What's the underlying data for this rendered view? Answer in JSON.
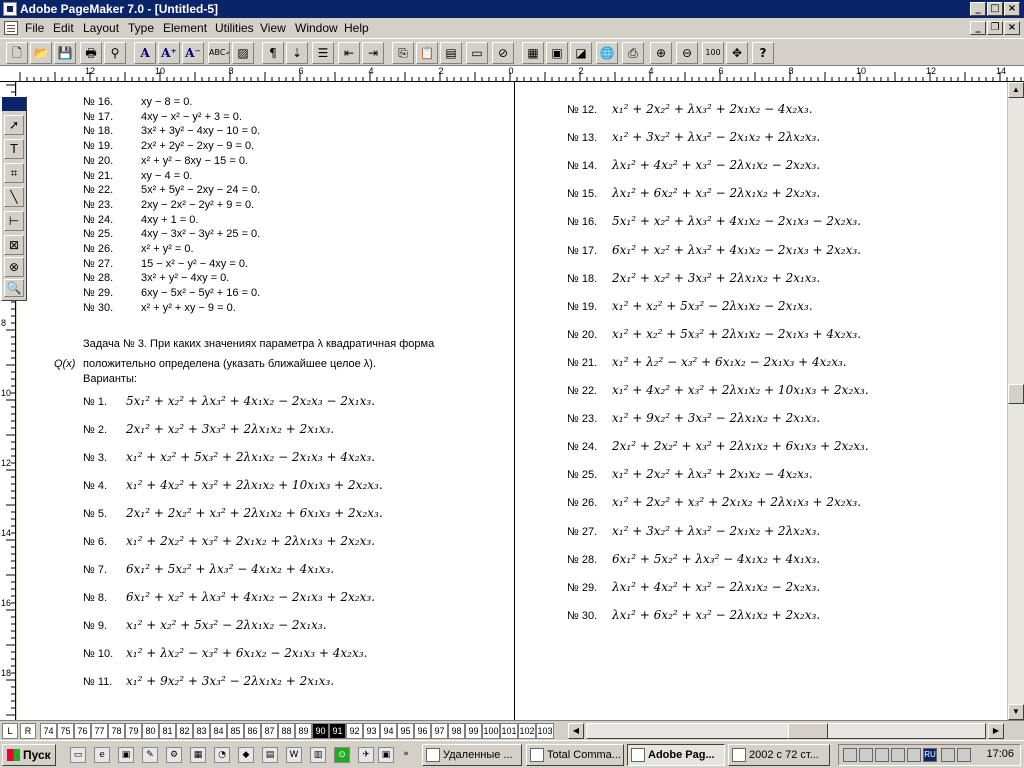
{
  "window": {
    "title": "Adobe PageMaker 7.0 - [Untitled-5]"
  },
  "menu": [
    "File",
    "Edit",
    "Layout",
    "Type",
    "Element",
    "Utilities",
    "View",
    "Window",
    "Help"
  ],
  "toolbar": {
    "buttons": [
      "new",
      "open",
      "save",
      "print",
      "find",
      "A",
      "A+",
      "A-",
      "spell",
      "rect",
      "¶",
      "text-flow",
      "bullets",
      "outdent",
      "indent",
      "copy",
      "paste",
      "clip",
      "frame",
      "link",
      "color",
      "place",
      "world",
      "print-pdf",
      "acrobat",
      "zoom-in",
      "zoom-out",
      "100",
      "fit",
      "?"
    ]
  },
  "hruler": {
    "labels": [
      "12",
      "10",
      "8",
      "6",
      "4",
      "2",
      "0",
      "2",
      "4",
      "6",
      "8",
      "10",
      "12",
      "14"
    ]
  },
  "vruler": {
    "labels": [
      "8",
      "10",
      "12",
      "14",
      "16",
      "18"
    ]
  },
  "toolbox": {
    "tools": [
      "pointer",
      "text",
      "crop",
      "line",
      "constrained-line",
      "rectangle-frame",
      "ellipse",
      "ellipse-frame",
      "zoom"
    ]
  },
  "left_eqs": [
    {
      "no": "№ 16.",
      "eq": "xy − 8 = 0."
    },
    {
      "no": "№ 17.",
      "eq": "4xy − x² − y² + 3 = 0."
    },
    {
      "no": "№ 18.",
      "eq": "3x² + 3y² − 4xy − 10 = 0."
    },
    {
      "no": "№ 19.",
      "eq": "2x² + 2y² − 2xy − 9 = 0."
    },
    {
      "no": "№ 20.",
      "eq": "x² + y² − 8xy − 15 = 0."
    },
    {
      "no": "№ 21.",
      "eq": "xy − 4 = 0."
    },
    {
      "no": "№ 22.",
      "eq": "5x² + 5y² − 2xy − 24 = 0."
    },
    {
      "no": "№ 23.",
      "eq": "2xy − 2x² − 2y² + 9 = 0."
    },
    {
      "no": "№ 24.",
      "eq": "4xy + 1 = 0."
    },
    {
      "no": "№ 25.",
      "eq": "4xy − 3x² − 3y² + 25 = 0."
    },
    {
      "no": "№ 26.",
      "eq": "x² + y² = 0."
    },
    {
      "no": "№ 27.",
      "eq": "15 − x² − y² − 4xy = 0."
    },
    {
      "no": "№ 28.",
      "eq": "3x² + y² − 4xy = 0."
    },
    {
      "no": "№ 29.",
      "eq": "6xy − 5x² − 5y² + 16 = 0."
    },
    {
      "no": "№ 30.",
      "eq": "x² + y² + xy − 9 = 0."
    }
  ],
  "task3": {
    "line1": "Задача № 3. При каких значениях параметра λ квадратичная форма",
    "qx": "Q(x)",
    "line2": "положительно определена (указать ближайшее целое λ).",
    "line3": "Варианты:"
  },
  "left_forms": [
    {
      "no": "№ 1.",
      "eq": "5x₁² + x₂² + λx₃² + 4x₁x₂ − 2x₂x₃ − 2x₁x₃."
    },
    {
      "no": "№ 2.",
      "eq": "2x₁² + x₂² + 3x₃² + 2λx₁x₂ + 2x₁x₃."
    },
    {
      "no": "№ 3.",
      "eq": "x₁² + x₂² + 5x₃² + 2λx₁x₂ − 2x₁x₃ + 4x₂x₃."
    },
    {
      "no": "№ 4.",
      "eq": "x₁² + 4x₂² + x₃² + 2λx₁x₂ + 10x₁x₃ + 2x₂x₃."
    },
    {
      "no": "№ 5.",
      "eq": "2x₁² + 2x₂² + x₃² + 2λx₁x₂ + 6x₁x₃ + 2x₂x₃."
    },
    {
      "no": "№ 6.",
      "eq": "x₁² + 2x₂² + x₃² + 2x₁x₂ + 2λx₁x₃ + 2x₂x₃."
    },
    {
      "no": "№ 7.",
      "eq": "6x₁² + 5x₂² + λx₃² − 4x₁x₂ + 4x₁x₃."
    },
    {
      "no": "№ 8.",
      "eq": "6x₁² + x₂² + λx₃² + 4x₁x₂ − 2x₁x₃ + 2x₂x₃."
    },
    {
      "no": "№ 9.",
      "eq": "x₁² + x₂² + 5x₃² − 2λx₁x₂ − 2x₁x₃."
    },
    {
      "no": "№ 10.",
      "eq": "x₁² + λx₂² − x₃² + 6x₁x₂ − 2x₁x₃ + 4x₂x₃."
    },
    {
      "no": "№ 11.",
      "eq": "x₁² + 9x₂² + 3x₃² − 2λx₁x₂ + 2x₁x₃."
    }
  ],
  "right_forms": [
    {
      "no": "№ 12.",
      "eq": "x₁² + 2x₂² + λx₃² + 2x₁x₂ − 4x₂x₃."
    },
    {
      "no": "№ 13.",
      "eq": "x₁² + 3x₂² + λx₃² − 2x₁x₂ + 2λx₂x₃."
    },
    {
      "no": "№ 14.",
      "eq": "λx₁² + 4x₂² + x₃² − 2λx₁x₂ − 2x₂x₃."
    },
    {
      "no": "№ 15.",
      "eq": "λx₁² + 6x₂² + x₃² − 2λx₁x₂ + 2x₂x₃."
    },
    {
      "no": "№ 16.",
      "eq": "5x₁² + x₂² + λx₃² + 4x₁x₂ − 2x₁x₃ − 2x₂x₃."
    },
    {
      "no": "№ 17.",
      "eq": "6x₁² + x₂² + λx₃² + 4x₁x₂ − 2x₁x₃ + 2x₂x₃."
    },
    {
      "no": "№ 18.",
      "eq": "2x₁² + x₂² + 3x₃² + 2λx₁x₂ + 2x₁x₃."
    },
    {
      "no": "№ 19.",
      "eq": "x₁² + x₂² + 5x₃² − 2λx₁x₂ − 2x₁x₃."
    },
    {
      "no": "№ 20.",
      "eq": "x₁² + x₂² + 5x₃² + 2λx₁x₂ − 2x₁x₃ + 4x₂x₃."
    },
    {
      "no": "№ 21.",
      "eq": "x₁² + λ₂² − x₃² + 6x₁x₂ − 2x₁x₃ + 4x₂x₃."
    },
    {
      "no": "№ 22.",
      "eq": "x₁² + 4x₂² + x₃² + 2λx₁x₂ + 10x₁x₃ + 2x₂x₃."
    },
    {
      "no": "№ 23.",
      "eq": "x₁² + 9x₂² + 3x₃² − 2λx₁x₂ + 2x₁x₃."
    },
    {
      "no": "№ 24.",
      "eq": "2x₁² + 2x₂² + x₃² + 2λx₁x₂ + 6x₁x₃ + 2x₂x₃."
    },
    {
      "no": "№ 25.",
      "eq": "x₁² + 2x₂² + λx₃² + 2x₁x₂ − 4x₂x₃."
    },
    {
      "no": "№ 26.",
      "eq": "x₁² + 2x₂² + x₃² + 2x₁x₂ + 2λx₁x₃ + 2x₂x₃."
    },
    {
      "no": "№ 27.",
      "eq": "x₁² + 3x₂² + λx₃² − 2x₁x₂ + 2λx₂x₃."
    },
    {
      "no": "№ 28.",
      "eq": "6x₁² + 5x₂² + λx₃² − 4x₁x₂ + 4x₁x₃."
    },
    {
      "no": "№ 29.",
      "eq": "λx₁² + 4x₂² + x₃² − 2λx₁x₂ − 2x₂x₃."
    },
    {
      "no": "№ 30.",
      "eq": "λx₁² + 6x₂² + x₃² − 2λx₁x₂ + 2x₂x₃."
    }
  ],
  "pagebar": {
    "L": "L",
    "R": "R",
    "pages": [
      "74",
      "75",
      "76",
      "77",
      "78",
      "79",
      "80",
      "81",
      "82",
      "83",
      "84",
      "85",
      "86",
      "87",
      "88",
      "89",
      "90",
      "91",
      "92",
      "93",
      "94",
      "95",
      "96",
      "97",
      "98",
      "99",
      "100",
      "101",
      "102",
      "103"
    ],
    "active": [
      "90",
      "91"
    ]
  },
  "taskbar": {
    "start": "Пуск",
    "tasks": [
      {
        "label": "Удаленные ...",
        "active": false
      },
      {
        "label": "Total Comma...",
        "active": false
      },
      {
        "label": "Adobe Pag...",
        "active": true
      },
      {
        "label": "2002 с 72 ст...",
        "active": false
      }
    ],
    "lang": "RU",
    "clock": "17:06"
  }
}
